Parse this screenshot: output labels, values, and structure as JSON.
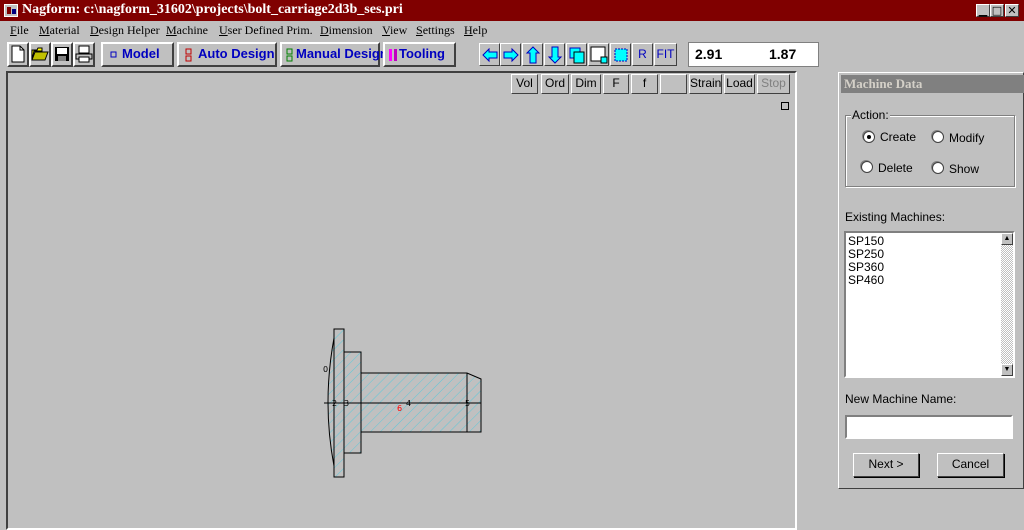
{
  "window": {
    "title": "Nagform: c:\\nagform_31602\\projects\\bolt_carriage2d3b_ses.pri",
    "min_glyph": "▁",
    "max_glyph": "□",
    "close_glyph": "✕"
  },
  "menu": [
    "File",
    "Material",
    "Design Helper",
    "Machine",
    "User Defined Prim.",
    "Dimension",
    "View",
    "Settings",
    "Help"
  ],
  "toolbar": {
    "file_icons": [
      "new-file-icon",
      "open-folder-icon",
      "save-disk-icon",
      "print-icon"
    ],
    "modes": [
      {
        "label": "Model",
        "icon": "model-icon"
      },
      {
        "label": "Auto Design",
        "icon": "auto-design-icon"
      },
      {
        "label": "Manual Design",
        "icon": "manual-design-icon"
      },
      {
        "label": "Tooling",
        "icon": "tooling-icon"
      }
    ],
    "nav_r_label": "R",
    "nav_fit_label": "FIT",
    "coord_x": "2.91",
    "coord_y": "1.87"
  },
  "canvas": {
    "buttons": [
      "Vol",
      "Ord",
      "Dim",
      "F",
      "f",
      "",
      "Strain",
      "Load",
      "Stop"
    ],
    "point_labels": {
      "p0": "0",
      "p2": "2",
      "p3": "3",
      "p4": "4",
      "p5": "5",
      "p6": "6"
    }
  },
  "panel": {
    "title": "Machine Data",
    "action_label": "Action:",
    "actions": {
      "create": "Create",
      "modify": "Modify",
      "delete": "Delete",
      "show": "Show"
    },
    "selected_action": "Create",
    "existing_label": "Existing Machines:",
    "machines": [
      "SP150",
      "SP250",
      "SP360",
      "SP460"
    ],
    "new_name_label": "New Machine Name:",
    "new_name_value": "",
    "next_label": "Next >",
    "cancel_label": "Cancel"
  }
}
